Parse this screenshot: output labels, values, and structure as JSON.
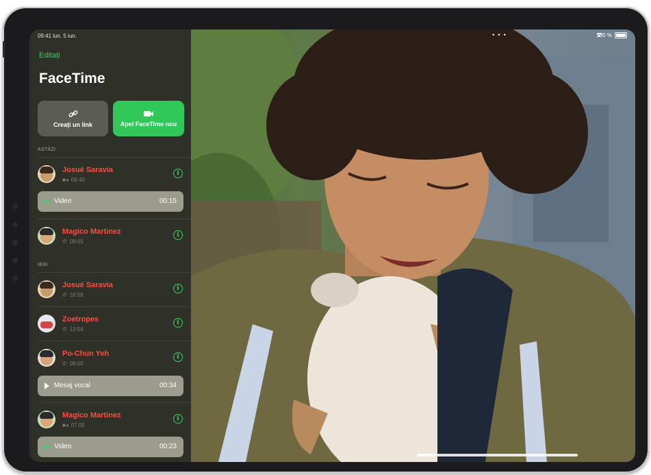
{
  "status_bar": {
    "time_date": "09:41 lun. 5 iun.",
    "battery": "100 %"
  },
  "header": {
    "edit_label": "Editați",
    "title": "FaceTime"
  },
  "actions": {
    "create_link_label": "Creați un link",
    "new_call_label": "Apel FaceTime nou"
  },
  "sections": {
    "today": "ASTĂZI",
    "yesterday": "IERI"
  },
  "calls": [
    {
      "name": "Josué Saravia",
      "time": "09:40",
      "kind": "video-icon"
    },
    {
      "name": "Magico Martinez",
      "time": "09:05",
      "kind": "phone-icon"
    },
    {
      "name": "Josué Saravia",
      "time": "16:58",
      "kind": "phone-icon"
    },
    {
      "name": "Zoetropes",
      "time": "13:54",
      "kind": "phone-icon"
    },
    {
      "name": "Po-Chun Yeh",
      "time": "08:00",
      "kind": "phone-icon"
    },
    {
      "name": "Magico Martinez",
      "time": "07:05",
      "kind": "video-icon"
    }
  ],
  "media": [
    {
      "label": "Video",
      "duration": "00:15"
    },
    {
      "label": "Mesaj vocal",
      "duration": "00:34"
    },
    {
      "label": "Video",
      "duration": "00:23"
    }
  ],
  "colors": {
    "accent_green": "#31c85a",
    "missed_red": "#ff4a3d",
    "sidebar_bg": "#2f3129"
  }
}
